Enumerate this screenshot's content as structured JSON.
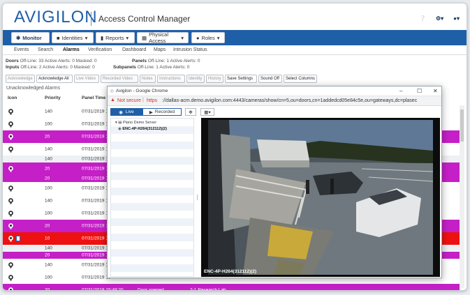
{
  "header": {
    "logo": "AVIGILON",
    "app_title": "Access Control Manager",
    "icons": [
      "help-icon",
      "gear-dropdown-icon",
      "user-dropdown-icon"
    ]
  },
  "menu": {
    "items": [
      {
        "label": "Monitor",
        "icon": "monitor-icon",
        "active": true
      },
      {
        "label": "Identities",
        "icon": "id-card-icon"
      },
      {
        "label": "Reports",
        "icon": "bar-chart-icon"
      },
      {
        "label": "Physical Access",
        "icon": "door-icon"
      },
      {
        "label": "Roles",
        "icon": "users-icon"
      }
    ]
  },
  "subnav": {
    "items": [
      "Events",
      "Search",
      "Alarms",
      "Verification",
      "Dashboard",
      "Maps",
      "Intrusion Status"
    ],
    "active": "Alarms"
  },
  "stats": {
    "line1_label1": "Doors",
    "line1_val1": "Off-Line: 33  Active Alerts: 0  Masked: 0",
    "line1_label2": "Panels",
    "line1_val2": "Off-Line: 1  Active Alerts: 0",
    "line2_label1": "Inputs",
    "line2_val1": "Off-Line: 2   Active Alerts: 0  Masked: 0",
    "line2_label2": "Subpanels",
    "line2_val2": "Off-Line: 1  Active Alerts: 0"
  },
  "toolbar": {
    "buttons": [
      {
        "label": "Acknowledge",
        "enabled": false
      },
      {
        "label": "Acknowledge All",
        "enabled": true
      },
      {
        "label": "Live Video",
        "enabled": false
      },
      {
        "label": "Recorded Video",
        "enabled": false
      },
      {
        "label": "Notes",
        "enabled": false
      },
      {
        "label": "Instructions",
        "enabled": false
      },
      {
        "label": "Identity",
        "enabled": false
      },
      {
        "label": "History",
        "enabled": false
      },
      {
        "label": "Save Settings",
        "enabled": true
      },
      {
        "label": "Sound Off",
        "enabled": true
      },
      {
        "label": "Select Columns",
        "enabled": true
      }
    ]
  },
  "alarms": {
    "title": "Unacknowledged Alarms",
    "columns": [
      "Icon",
      "Priority",
      "Panel Time"
    ],
    "rows": [
      {
        "priority": "140",
        "time": "07/31/2019 15",
        "color": "white"
      },
      {
        "priority": "100",
        "time": "07/31/2019 15",
        "color": "white"
      },
      {
        "priority": "20",
        "time": "07/31/2019 15",
        "color": "mag"
      },
      {
        "priority": "140",
        "time": "07/31/2019 15",
        "color": "white"
      },
      {
        "priority": "140",
        "time": "07/31/2019 15",
        "color": "gray"
      },
      {
        "priority": "20",
        "time": "07/31/2019 15",
        "color": "mag"
      },
      {
        "priority": "20",
        "time": "07/31/2019 15",
        "color": "mag"
      },
      {
        "priority": "100",
        "time": "07/31/2019 15",
        "color": "white"
      },
      {
        "priority": "140",
        "time": "07/31/2019 15",
        "color": "white"
      },
      {
        "priority": "100",
        "time": "07/31/2019 15",
        "color": "white"
      },
      {
        "priority": "20",
        "time": "07/31/2019 15",
        "color": "mag"
      },
      {
        "priority": "10",
        "time": "07/31/2019 15",
        "color": "red"
      },
      {
        "priority": "140",
        "time": "07/31/2019 15",
        "color": "gray"
      },
      {
        "priority": "20",
        "time": "07/31/2019 15",
        "color": "mag"
      },
      {
        "priority": "140",
        "time": "07/31/2019 15",
        "color": "white"
      },
      {
        "priority": "100",
        "time": "07/31/2019 15",
        "color": "white"
      },
      {
        "priority": "20",
        "time": "07/31/2019 15:48:20",
        "event": "Door opened",
        "location": "2-1 Research Lab",
        "color": "mag"
      }
    ]
  },
  "popup": {
    "title": "Avigilon - Google Chrome",
    "not_secure": "Not secure",
    "https": "https",
    "url_rest": "://dallas-acm.demo.avigilon.com:4443/cameras/show/cn=5,ou=doors,cn=1addedcd05e84c5e,ou=gateways,dc=plasec",
    "live_label": "Live",
    "recorded_label": "Recorded",
    "tree_root": "Plano Demo Server",
    "tree_camera": "ENC-4P-H264(312112)(2)",
    "video_label": "ENC-4P-H264(312112)(2)"
  },
  "colors": {
    "brand": "#1f5fa8",
    "magenta": "#c51fc7",
    "red": "#ee1111"
  }
}
